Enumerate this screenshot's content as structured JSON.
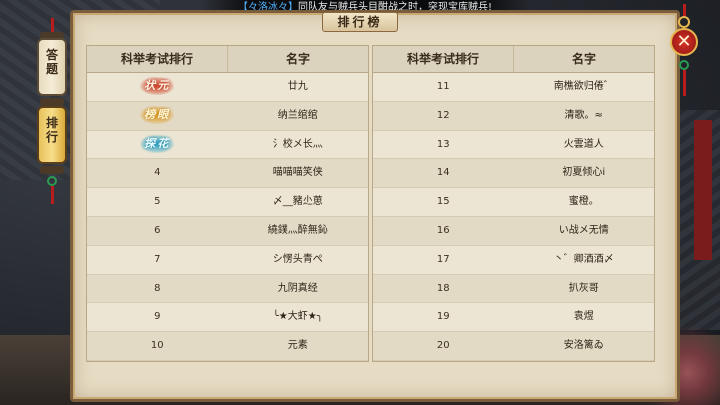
{
  "notice": {
    "sender": "【々洛冰々】",
    "message": "同队友与贼兵头目酣战之时，突现宝库贼兵!"
  },
  "panel": {
    "title": "排行榜"
  },
  "tabs": [
    {
      "label": "答题",
      "chars": [
        "答",
        "题"
      ],
      "active": false
    },
    {
      "label": "排行",
      "chars": [
        "排",
        "行"
      ],
      "active": true
    }
  ],
  "table": {
    "col_rank": "科举考试排行",
    "col_name": "名字",
    "left_rows": [
      {
        "rank": "状元",
        "name": "廿九",
        "badge": "gold1"
      },
      {
        "rank": "榜眼",
        "name": "纳兰绾绾",
        "badge": "gold2"
      },
      {
        "rank": "探花",
        "name": "氵校メ长灬",
        "badge": "blue"
      },
      {
        "rank": "4",
        "name": "喵喵喵笑侠"
      },
      {
        "rank": "5",
        "name": "〆__豬尐葸"
      },
      {
        "rank": "6",
        "name": "繞鏷灬醉無鈊"
      },
      {
        "rank": "7",
        "name": "シ愣头青ぺ"
      },
      {
        "rank": "8",
        "name": "九阴真经"
      },
      {
        "rank": "9",
        "name": "╰★大虾★╮"
      },
      {
        "rank": "10",
        "name": "元素"
      }
    ],
    "right_rows": [
      {
        "rank": "11",
        "name": "南樵欲归倦゛"
      },
      {
        "rank": "12",
        "name": "清歌。≈"
      },
      {
        "rank": "13",
        "name": "火雲道人"
      },
      {
        "rank": "14",
        "name": "初夏倾心ⅰ"
      },
      {
        "rank": "15",
        "name": "蜜橙。"
      },
      {
        "rank": "16",
        "name": "い战メ无情"
      },
      {
        "rank": "17",
        "name": "丶゛卿酒酒〆"
      },
      {
        "rank": "18",
        "name": "扒灰哥"
      },
      {
        "rank": "19",
        "name": "袁煜"
      },
      {
        "rank": "20",
        "name": "安洛篱ゐ"
      }
    ]
  },
  "close_label": "✕",
  "colors": {
    "panel_bg": "#e6dcc4",
    "frame": "#7a5d3a",
    "close_red": "#d9322a",
    "tab_active": "#f7de8c"
  }
}
